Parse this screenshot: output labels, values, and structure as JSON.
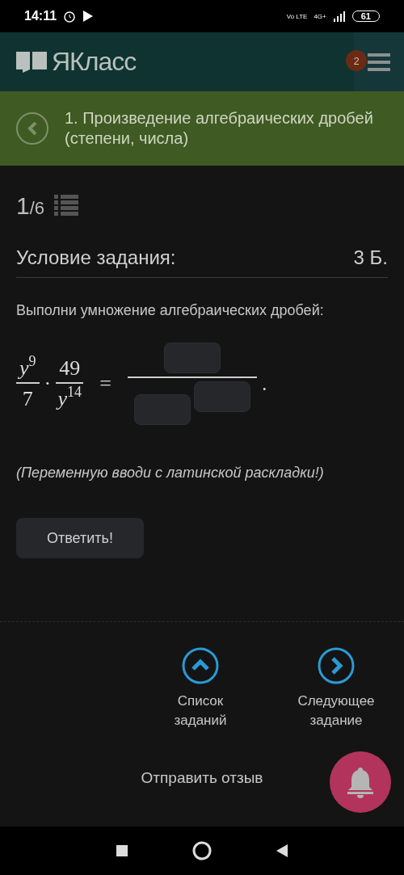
{
  "status_bar": {
    "time": "14:11",
    "network": "4G+",
    "volte": "Vo LTE",
    "battery": "61"
  },
  "header": {
    "logo": "ЯКласс",
    "badge": "2"
  },
  "topic": {
    "title": "1. Произведение алгебраических дробей (степени, числа)"
  },
  "progress": {
    "current": "1",
    "total": "/6"
  },
  "task": {
    "heading": "Условие задания:",
    "points": "3 Б.",
    "instruction": "Выполни умножение алгебраических дробей:",
    "expression": {
      "f1_num_base": "y",
      "f1_num_exp": "9",
      "f1_den": "7",
      "dot": "·",
      "f2_num": "49",
      "f2_den_base": "y",
      "f2_den_exp": "14",
      "equals": "=",
      "end": "."
    },
    "note": "(Переменную вводи с латинской раскладки!)",
    "answer_button": "Ответить!"
  },
  "nav": [
    {
      "kind": "up",
      "label_1": "Список",
      "label_2": "заданий"
    },
    {
      "kind": "next",
      "label_1": "Следующее",
      "label_2": "задание"
    }
  ],
  "feedback": "Отправить отзыв"
}
